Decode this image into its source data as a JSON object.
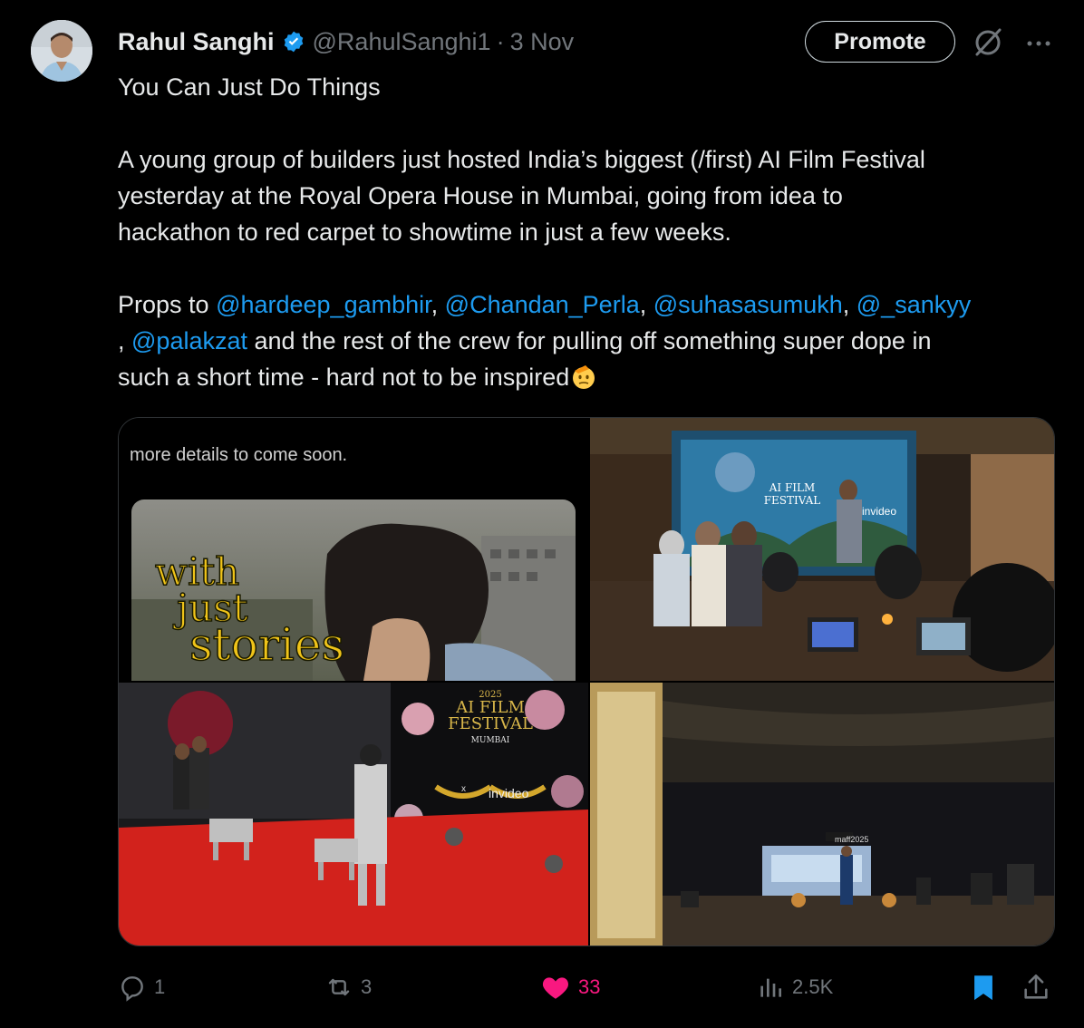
{
  "author": {
    "name": "Rahul Sanghi",
    "handle": "@RahulSanghi1",
    "separator": "·",
    "date": "3 Nov"
  },
  "header": {
    "promote_label": "Promote"
  },
  "tweet": {
    "title": "You Can Just Do Things",
    "paragraph1_lines": [
      "A young group of builders just hosted India’s biggest (/first) AI Film Festival",
      "yesterday at the Royal Opera House in Mumbai, going from idea to",
      "hackathon to red carpet to showtime in just a few weeks."
    ],
    "props_prefix": "Props to ",
    "mentions": [
      "@hardeep_gambhir",
      "@Chandan_Perla",
      "@suhasasumukh",
      "@_sankyy",
      "@palakzat"
    ],
    "comma": ", ",
    "leading_comma": ", ",
    "props_line2_suffix": " and the rest of the crew for pulling off something super dope in",
    "props_line3": "such a short time - hard not to be inspired"
  },
  "media": {
    "image1_caption": "more details to come soon.",
    "image1_overlay_words": [
      "with",
      "just",
      "stories"
    ],
    "image2_screen_text": "AI FILM FESTIVAL",
    "image2_brand": "invideo",
    "image3_sign_year": "2025",
    "image3_sign_title_1": "AI FILM",
    "image3_sign_title_2": "FESTIVAL",
    "image3_sign_city": "MUMBAI",
    "image3_brand": "invideo",
    "image3_x": "x",
    "image4_screen_text": "maff2025"
  },
  "actions": {
    "replies": "1",
    "reposts": "3",
    "likes": "33",
    "views": "2.5K"
  },
  "colors": {
    "background": "#000000",
    "text": "#e7e9ea",
    "muted": "#71767b",
    "link": "#1d9bf0",
    "like": "#f91880",
    "bookmark": "#1d9bf0"
  }
}
